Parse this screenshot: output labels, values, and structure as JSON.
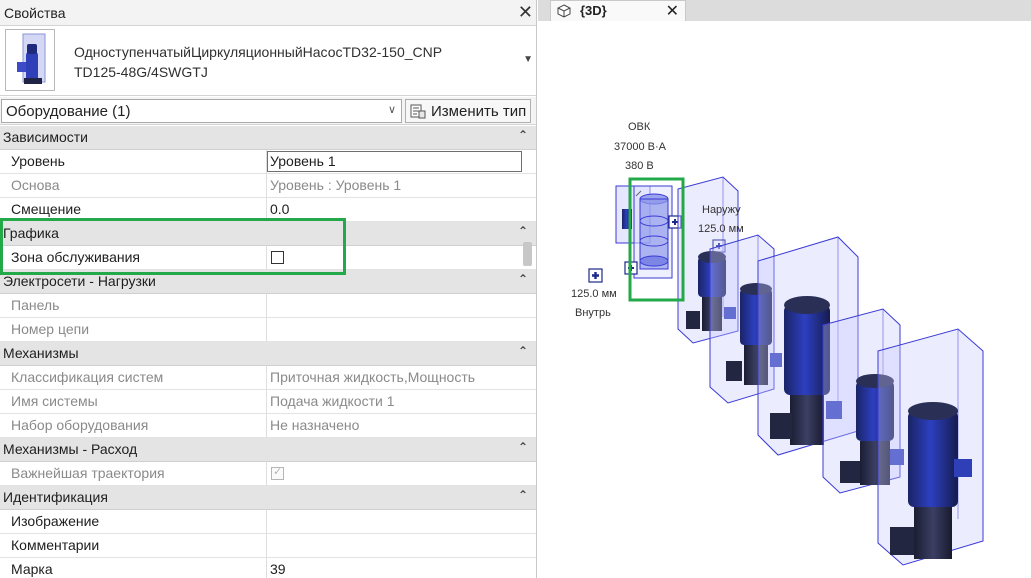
{
  "properties": {
    "title": "Свойства",
    "close": "✕",
    "type_name_line1": "ОдноступенчатыйЦиркуляционныйНасосTD32-150_CNP",
    "type_name_line2": "TD125-48G/4SWGTJ",
    "filter_value": "Оборудование (1)",
    "edit_type_label": "Изменить тип",
    "groups": {
      "g1": "Зависимости",
      "g2": "Графика",
      "g3": "Электросети - Нагрузки",
      "g4": "Механизмы",
      "g5": "Механизмы - Расход",
      "g6": "Идентификация"
    },
    "rows": {
      "level": {
        "label": "Уровень",
        "value": "Уровень 1"
      },
      "host": {
        "label": "Основа",
        "value": "Уровень : Уровень 1"
      },
      "offset": {
        "label": "Смещение",
        "value": "0.0"
      },
      "service_zone": {
        "label": "Зона обслуживания",
        "checked": false
      },
      "panel": {
        "label": "Панель",
        "value": ""
      },
      "circuit": {
        "label": "Номер цепи",
        "value": ""
      },
      "sys_class": {
        "label": "Классификация систем",
        "value": "Приточная жидкость,Мощность"
      },
      "sys_name": {
        "label": "Имя системы",
        "value": "Подача жидкости 1"
      },
      "equip_set": {
        "label": "Набор оборудования",
        "value": "Не назначено"
      },
      "critical_path": {
        "label": "Важнейшая траектория",
        "checked": true
      },
      "image": {
        "label": "Изображение",
        "value": ""
      },
      "comments": {
        "label": "Комментарии",
        "value": ""
      },
      "mark": {
        "label": "Марка",
        "value": "39"
      }
    }
  },
  "view": {
    "tab_label": "{3D}",
    "tab_close": "✕",
    "annotations": {
      "ovk": "ОВК",
      "power": "37000 В·А",
      "voltage": "380 В",
      "outside": "Наружу",
      "outside_size": "125.0 мм",
      "inside_size": "125.0 мм",
      "inside": "Внутрь"
    }
  },
  "colors": {
    "highlight": "#23a84a",
    "pump_body": "#2b3cbf",
    "pump_dark": "#1f2444",
    "zone_fill": "#c8c8ff",
    "zone_edge": "#3a3ad6"
  }
}
